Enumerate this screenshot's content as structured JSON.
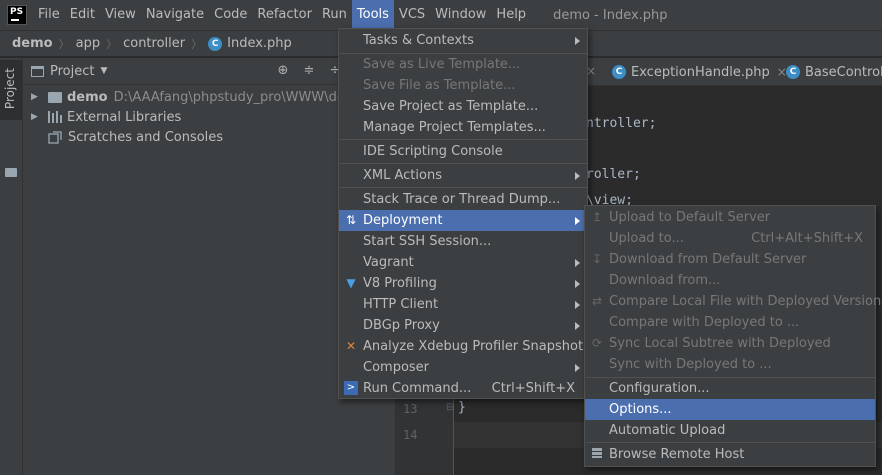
{
  "app": {
    "icon_text": "PS",
    "window_title": "demo - Index.php"
  },
  "menubar": {
    "items": [
      {
        "label": "File"
      },
      {
        "label": "Edit"
      },
      {
        "label": "View"
      },
      {
        "label": "Navigate"
      },
      {
        "label": "Code"
      },
      {
        "label": "Refactor"
      },
      {
        "label": "Run"
      },
      {
        "label": "Tools"
      },
      {
        "label": "VCS"
      },
      {
        "label": "Window"
      },
      {
        "label": "Help"
      }
    ],
    "active": "Tools"
  },
  "breadcrumb": {
    "items": [
      "demo",
      "app",
      "controller",
      "Index.php"
    ]
  },
  "side_strip": {
    "project_tab": "Project"
  },
  "project_panel": {
    "title": "Project",
    "tree": [
      {
        "name": "demo",
        "path": "D:\\AAAfang\\phpstudy_pro\\WWW\\demo"
      },
      {
        "name": "External Libraries"
      },
      {
        "name": "Scratches and Consoles"
      }
    ]
  },
  "editor": {
    "tabs": [
      {
        "label": "ExceptionHandle.php"
      },
      {
        "label": "BaseControlle"
      }
    ],
    "code_fragments": [
      "ntroller;",
      "roller;",
      "\\view;"
    ],
    "lines": [
      {
        "num": "13",
        "text": "}"
      },
      {
        "num": "14",
        "text": ""
      }
    ]
  },
  "tools_menu": {
    "items": [
      {
        "label": "Tasks & Contexts",
        "submenu": true
      },
      {
        "label": "Save as Live Template...",
        "disabled": true
      },
      {
        "label": "Save File as Template...",
        "disabled": true
      },
      {
        "label": "Save Project as Template..."
      },
      {
        "label": "Manage Project Templates..."
      },
      {
        "label": "IDE Scripting Console"
      },
      {
        "label": "XML Actions",
        "submenu": true
      },
      {
        "label": "Stack Trace or Thread Dump..."
      },
      {
        "label": "Deployment",
        "submenu": true,
        "highlighted": true
      },
      {
        "label": "Start SSH Session..."
      },
      {
        "label": "Vagrant",
        "submenu": true
      },
      {
        "label": "V8 Profiling",
        "submenu": true
      },
      {
        "label": "HTTP Client",
        "submenu": true
      },
      {
        "label": "DBGp Proxy",
        "submenu": true
      },
      {
        "label": "Analyze Xdebug Profiler Snapshot..."
      },
      {
        "label": "Composer",
        "submenu": true
      },
      {
        "label": "Run Command...",
        "shortcut": "Ctrl+Shift+X"
      }
    ]
  },
  "deployment_menu": {
    "items": [
      {
        "label": "Upload to Default Server",
        "disabled": true
      },
      {
        "label": "Upload to...",
        "shortcut": "Ctrl+Alt+Shift+X",
        "disabled": true
      },
      {
        "label": "Download from Default Server",
        "disabled": true
      },
      {
        "label": "Download from...",
        "disabled": true
      },
      {
        "label": "Compare Local File with Deployed Version",
        "disabled": true
      },
      {
        "label": "Compare with Deployed to ...",
        "disabled": true
      },
      {
        "label": "Sync Local Subtree with Deployed",
        "disabled": true
      },
      {
        "label": "Sync with Deployed to ...",
        "disabled": true
      },
      {
        "label": "Configuration..."
      },
      {
        "label": "Options...",
        "highlighted": true
      },
      {
        "label": "Automatic Upload"
      },
      {
        "label": "Browse Remote Host"
      }
    ]
  },
  "colors": {
    "accent": "#4b6eaf",
    "background": "#2b2b2b",
    "panel": "#3c3f41",
    "text": "#bbbbbb",
    "disabled": "#777777"
  }
}
